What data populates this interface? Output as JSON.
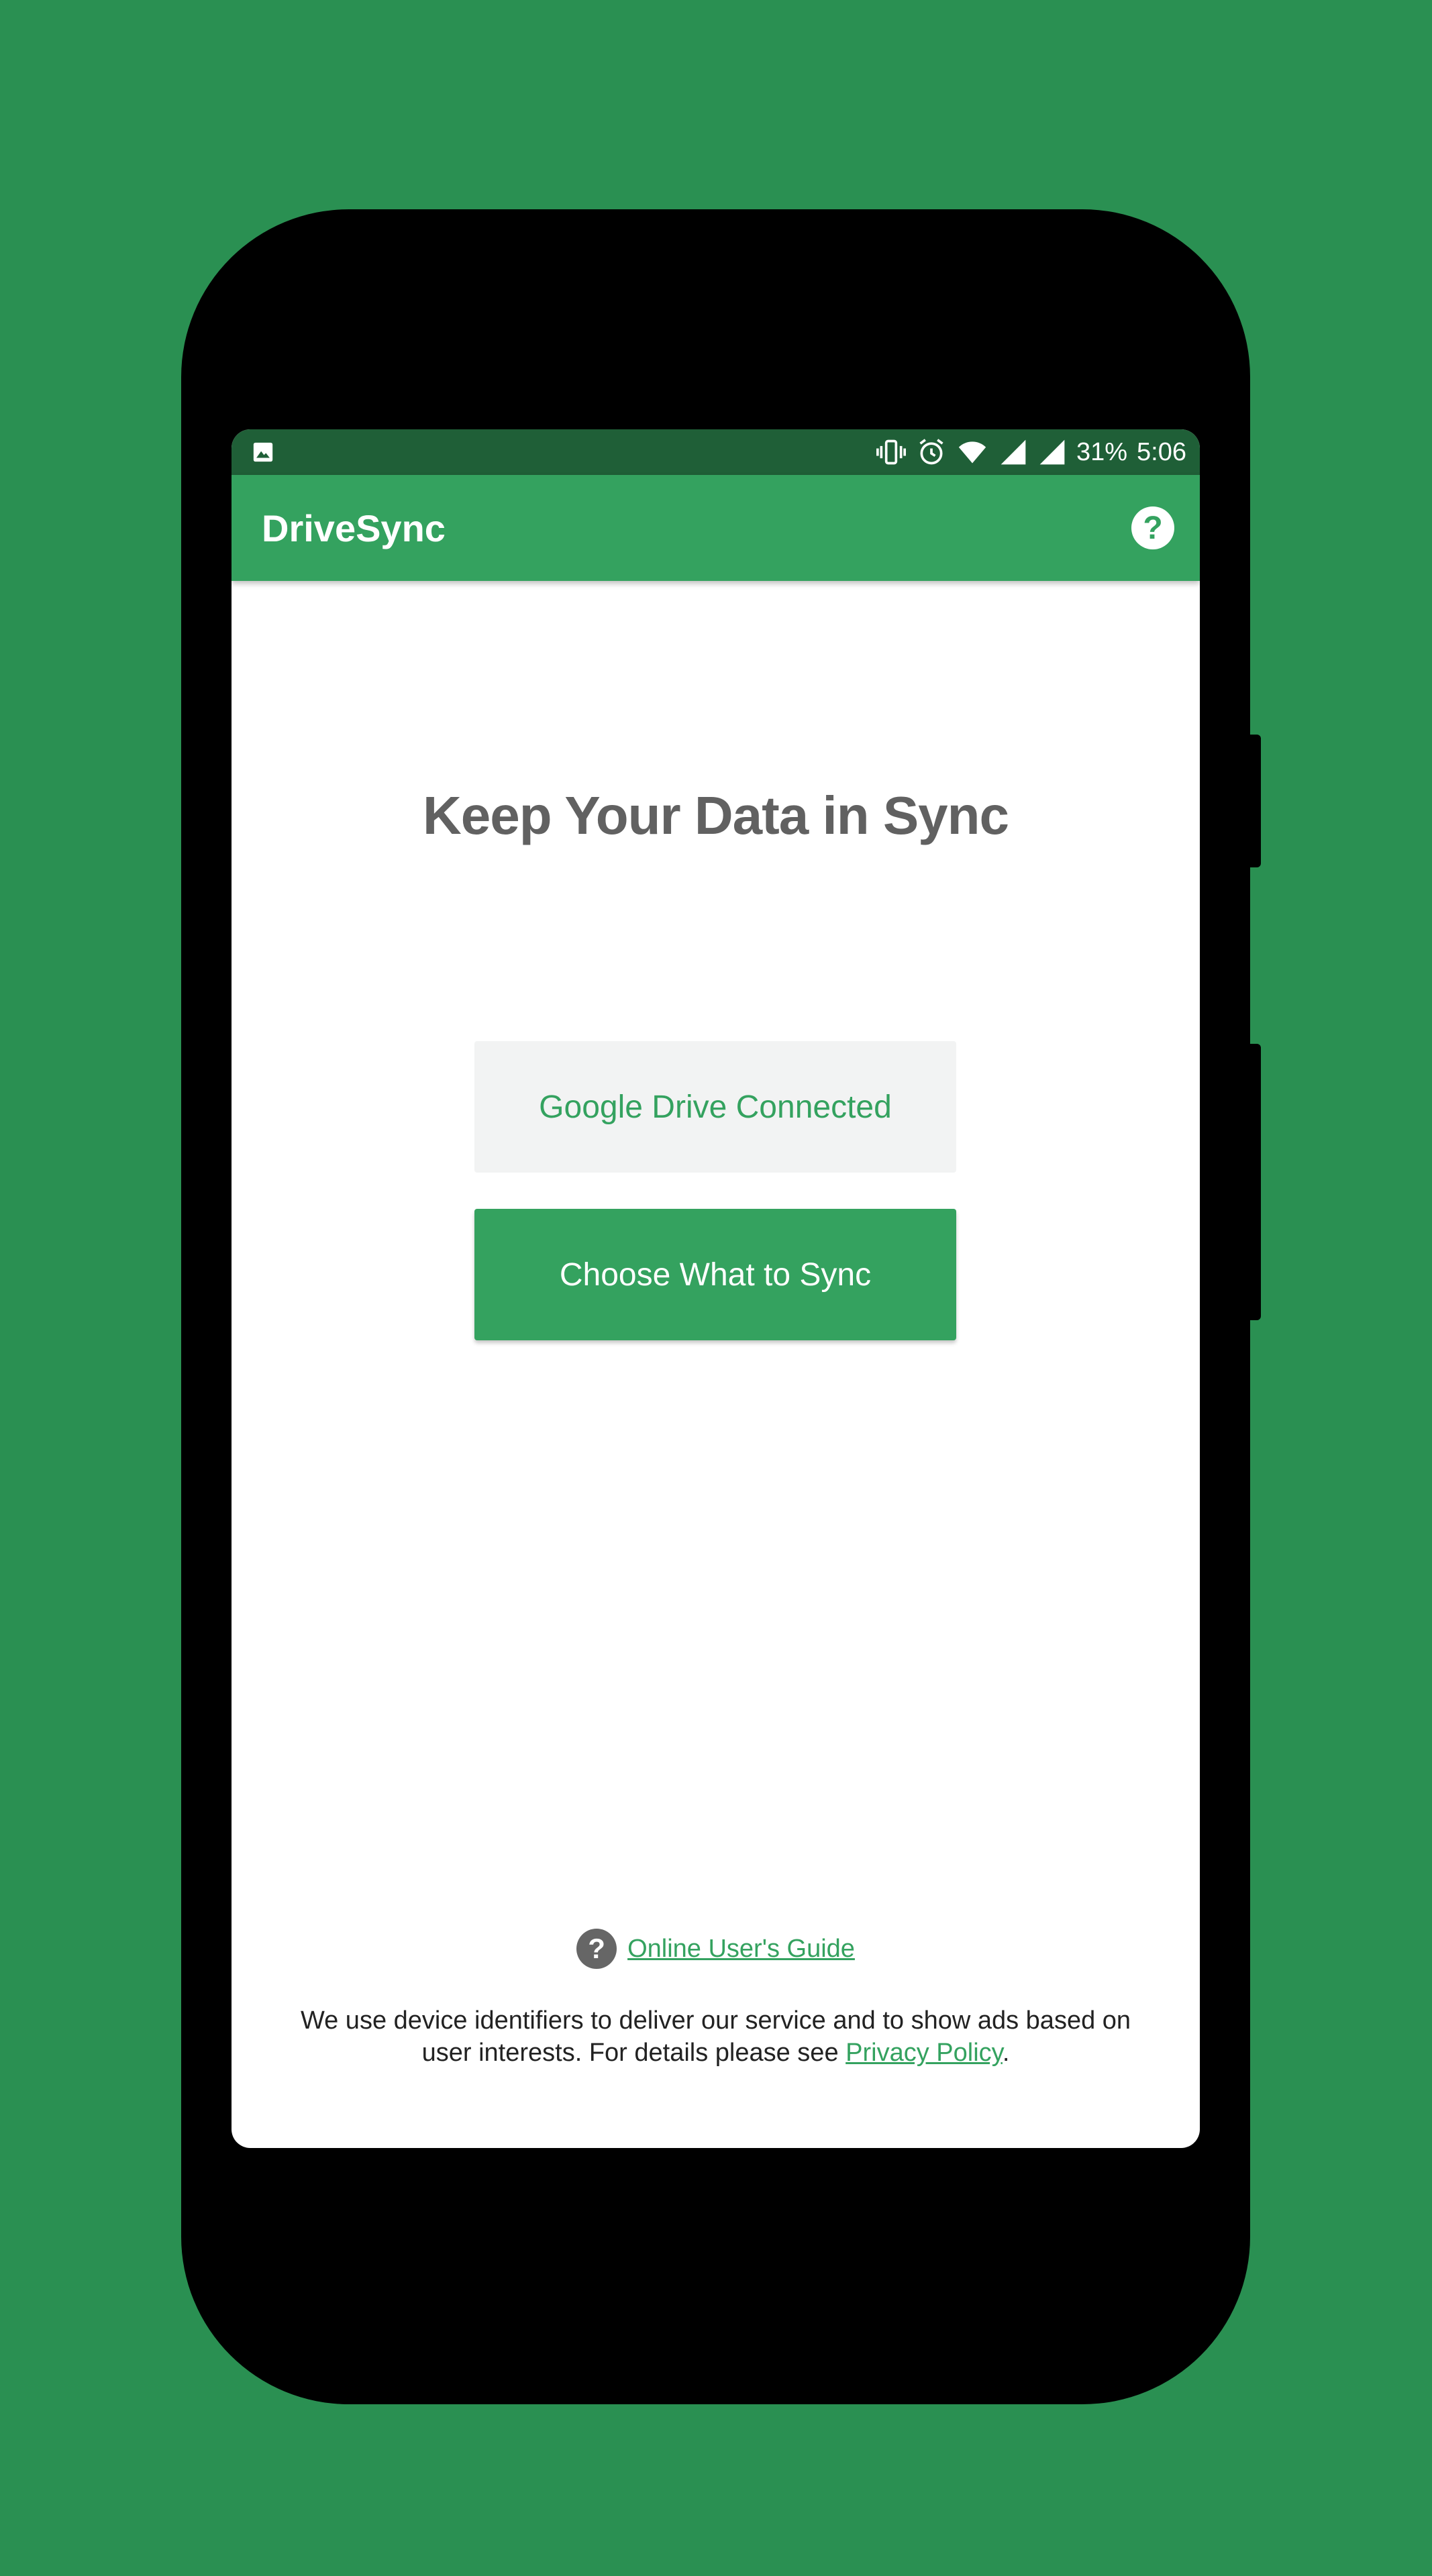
{
  "colors": {
    "background": "#2a9052",
    "brand_green": "#34a25f",
    "status_bar": "#1f5f37",
    "headline_gray": "#616161"
  },
  "status_bar": {
    "left_icons": [
      "image-notification-icon"
    ],
    "right_icons": [
      "vibrate-icon",
      "alarm-icon",
      "wifi-icon",
      "signal-icon",
      "signal-icon-2"
    ],
    "battery": "31%",
    "time": "5:06"
  },
  "app_bar": {
    "title": "DriveSync",
    "help_icon": "help-circle-icon"
  },
  "main": {
    "headline": "Keep Your Data in Sync",
    "connected_button_label": "Google Drive Connected",
    "choose_button_label": "Choose What to Sync"
  },
  "footer": {
    "guide_icon": "help-circle-icon",
    "guide_link": "Online User's Guide",
    "disclaimer_text": "We use device identifiers to deliver our service and to show ads based on user interests. For details please see ",
    "privacy_link": "Privacy Policy",
    "disclaimer_end": "."
  }
}
